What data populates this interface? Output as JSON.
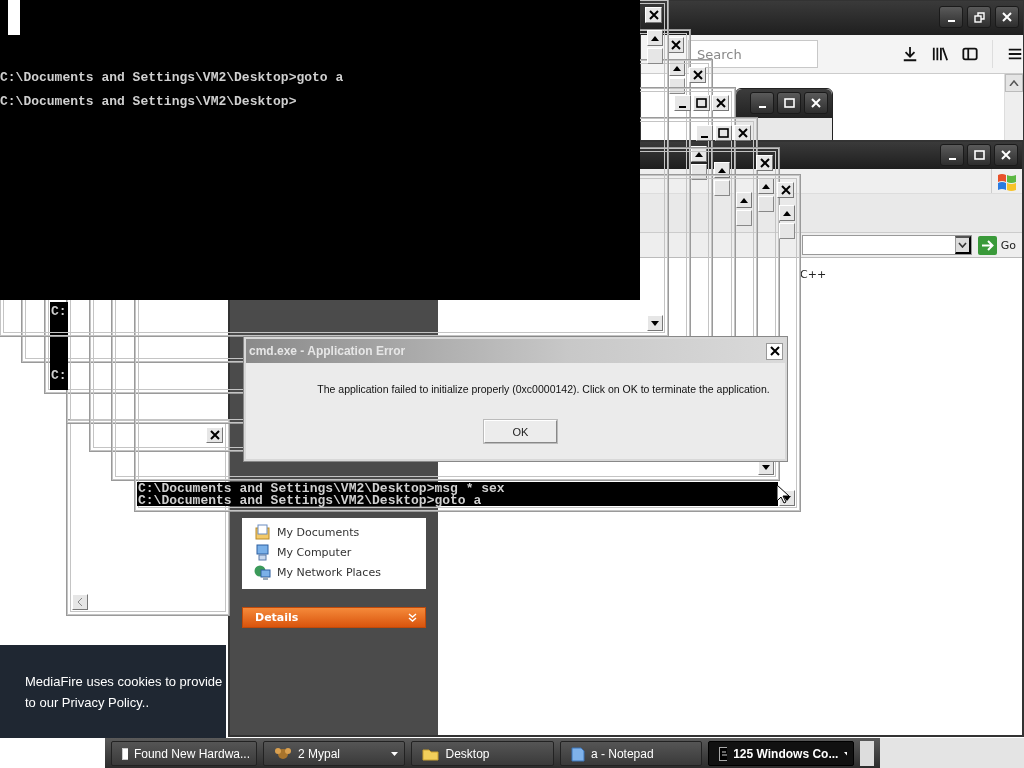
{
  "browser": {
    "search": {
      "placeholder": "Search"
    }
  },
  "explorer": {
    "content_text": "C++",
    "go_button": "Go",
    "places": [
      "My Documents",
      "My Computer",
      "My Network Places"
    ],
    "details_panel": {
      "title": "Details",
      "expanded": false
    }
  },
  "console_fragment": {
    "lines": [
      "C:",
      "C:"
    ]
  },
  "bottom_console": {
    "lines": [
      "C:\\Documents and Settings\\VM2\\Desktop>msg * sex",
      "C:\\Documents and Settings\\VM2\\Desktop>goto a"
    ]
  },
  "console": {
    "lines": [
      "C:\\Documents and Settings\\VM2\\Desktop>goto a",
      "C:\\Documents and Settings\\VM2\\Desktop>"
    ]
  },
  "error_dialog": {
    "title": "cmd.exe - Application Error",
    "message": "The application failed to initialize properly (0xc0000142). Click on OK to terminate the application.",
    "button": "OK"
  },
  "cookie_banner": {
    "lines": [
      "MediaFire uses cookies to provide",
      "to our Privacy Policy.."
    ]
  },
  "taskbar": {
    "buttons": [
      {
        "label": "Found New Hardwa...",
        "kind": "window",
        "grouped": false,
        "selected": false
      },
      {
        "label": "2 Mypal",
        "kind": "app",
        "grouped": true,
        "selected": false
      },
      {
        "label": "Desktop",
        "kind": "folder",
        "grouped": false,
        "selected": false
      },
      {
        "label": "a - Notepad",
        "kind": "notepad",
        "grouped": false,
        "selected": false
      },
      {
        "label": "125 Windows Co...",
        "kind": "console",
        "grouped": true,
        "selected": true
      }
    ]
  }
}
